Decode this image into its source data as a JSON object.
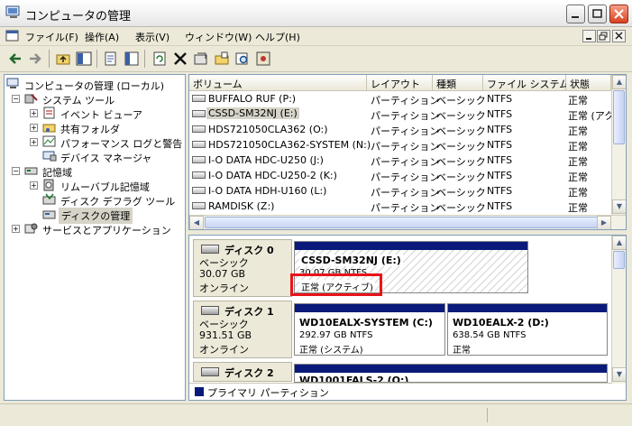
{
  "window": {
    "title": "コンピュータの管理"
  },
  "menu": [
    "ファイル(F)",
    "操作(A)",
    "表示(V)",
    "ウィンドウ(W)",
    "ヘルプ(H)"
  ],
  "tree": {
    "root": "コンピュータの管理 (ローカル)",
    "system_tools": "システム ツール",
    "event_viewer": "イベント ビューア",
    "shared_folders": "共有フォルダ",
    "performance": "パフォーマンス ログと警告",
    "device_manager": "デバイス マネージャ",
    "storage": "記憶域",
    "removable": "リムーバブル記憶域",
    "defrag": "ディスク デフラグ ツール",
    "disk_mgmt": "ディスクの管理",
    "services": "サービスとアプリケーション"
  },
  "volumes": {
    "headers": [
      "ボリューム",
      "レイアウト",
      "種類",
      "ファイル システム",
      "状態"
    ],
    "rows": [
      [
        "BUFFALO RUF (P:)",
        "パーティション",
        "ベーシック",
        "NTFS",
        "正常"
      ],
      [
        "CSSD-SM32NJ (E:)",
        "パーティション",
        "ベーシック",
        "NTFS",
        "正常 (アク"
      ],
      [
        "HDS721050CLA362 (O:)",
        "パーティション",
        "ベーシック",
        "NTFS",
        "正常"
      ],
      [
        "HDS721050CLA362-SYSTEM (N:)",
        "パーティション",
        "ベーシック",
        "NTFS",
        "正常"
      ],
      [
        "I-O DATA HDC-U250 (J:)",
        "パーティション",
        "ベーシック",
        "NTFS",
        "正常"
      ],
      [
        "I-O DATA HDC-U250-2 (K:)",
        "パーティション",
        "ベーシック",
        "NTFS",
        "正常"
      ],
      [
        "I-O DATA HDH-U160 (L:)",
        "パーティション",
        "ベーシック",
        "NTFS",
        "正常"
      ],
      [
        "RAMDISK (Z:)",
        "パーティション",
        "ベーシック",
        "NTFS",
        "正常"
      ]
    ]
  },
  "disks": {
    "d0": {
      "name": "ディスク 0",
      "type": "ベーシック",
      "size": "30.07 GB",
      "status": "オンライン",
      "part": {
        "name": "CSSD-SM32NJ  (E:)",
        "detail": "30.07 GB NTFS",
        "state": "正常 (アクティブ)"
      }
    },
    "d1": {
      "name": "ディスク 1",
      "type": "ベーシック",
      "size": "931.51 GB",
      "status": "オンライン",
      "p1": {
        "name": "WD10EALX-SYSTEM  (C:)",
        "detail": "292.97 GB NTFS",
        "state": "正常 (システム)"
      },
      "p2": {
        "name": "WD10EALX-2  (D:)",
        "detail": "638.54 GB NTFS",
        "state": "正常"
      }
    },
    "d2": {
      "name": "ディスク 2",
      "partial_name": "WD1001FALS-2  (Q:)"
    }
  },
  "legend": "プライマリ パーティション",
  "colors": {
    "partition_bar": "#0a1a7a",
    "highlight": "#e8141b"
  }
}
